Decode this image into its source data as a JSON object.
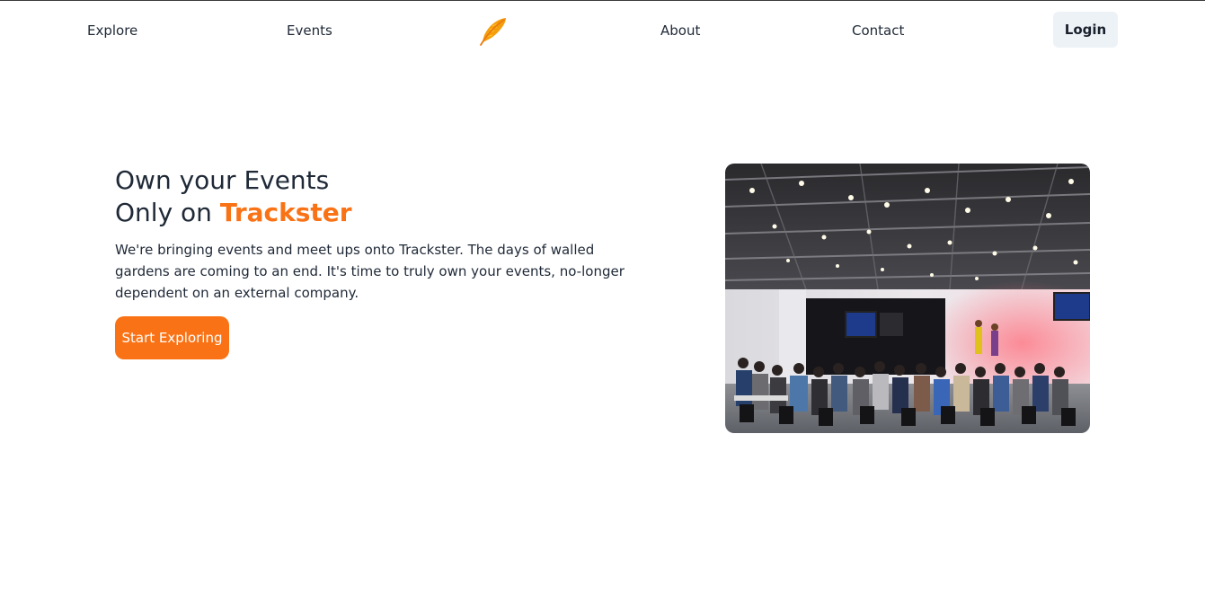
{
  "nav": {
    "explore_label": "Explore",
    "events_label": "Events",
    "about_label": "About",
    "contact_label": "Contact",
    "login_label": "Login",
    "logo_icon": "feather-icon"
  },
  "hero": {
    "headline_line1": "Own your Events",
    "headline_line2_prefix": "Only on ",
    "brand_name": "Trackster",
    "description": "We're bringing events and meet ups onto Trackster. The days of walled gardens are coming to an end. It's time to truly own your events, no-longer dependent on an external company.",
    "cta_label": "Start Exploring"
  },
  "colors": {
    "accent": "#f97316",
    "login_bg": "#edf2f7",
    "text": "#1f2937"
  }
}
